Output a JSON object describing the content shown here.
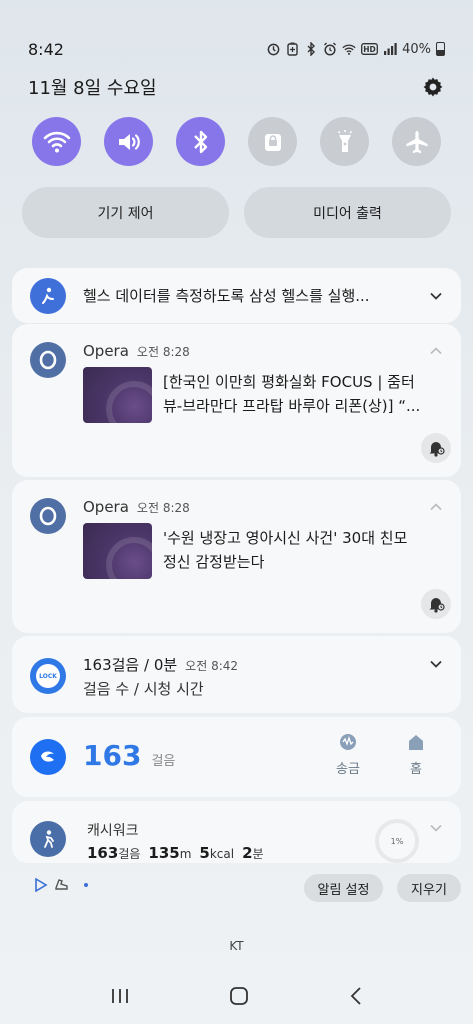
{
  "status_bar": {
    "time": "8:42",
    "battery_percent": "40%",
    "icons": [
      "sync-icon",
      "battery-saver-icon",
      "bluetooth-icon",
      "alarm-icon",
      "wifi-icon",
      "hd-icon",
      "signal-icon",
      "battery-icon"
    ]
  },
  "header": {
    "date": "11월 8일 수요일",
    "settings_icon": "gear-icon"
  },
  "quick_settings": [
    {
      "name": "wifi",
      "on": true
    },
    {
      "name": "sound",
      "on": true
    },
    {
      "name": "bluetooth",
      "on": true
    },
    {
      "name": "rotation-lock",
      "on": false
    },
    {
      "name": "flashlight",
      "on": false
    },
    {
      "name": "airplane",
      "on": false
    }
  ],
  "pills": {
    "device_control": "기기 제어",
    "media_output": "미디어 출력"
  },
  "notifications": {
    "health": {
      "text": "헬스 데이터를 측정하도록 삼성 헬스를 실행..."
    },
    "opera1": {
      "app": "Opera",
      "time": "오전 8:28",
      "line1": "[한국인 이만희 평화실화 FOCUS | 줌터",
      "line2": "뷰-브라만다 프라탑 바루아 리폰(상)] “..."
    },
    "opera2": {
      "app": "Opera",
      "time": "오전 8:28",
      "line1": "'수원 냉장고 영아시신 사건' 30대 친모",
      "line2": "정신 감정받는다"
    },
    "steps": {
      "title": "163걸음 / 0분",
      "time": "오전 8:42",
      "subtitle": "걸음 수 / 시청 시간"
    },
    "toss": {
      "count": "163",
      "unit": "걸음",
      "send_label": "송금",
      "home_label": "홈"
    },
    "cashwalk": {
      "app": "캐시워크",
      "steps": "163",
      "steps_unit": "걸음",
      "distance": "135",
      "distance_unit": "m",
      "kcal": "5",
      "kcal_unit": "kcal",
      "minutes": "2",
      "minutes_unit": "분",
      "progress": "1%"
    }
  },
  "footer": {
    "alarm_settings": "알림 설정",
    "clear": "지우기",
    "carrier": "KT"
  },
  "colors": {
    "accent": "#8676ea",
    "toss_blue": "#1f6ff2",
    "step_blue": "#2f78e6"
  }
}
